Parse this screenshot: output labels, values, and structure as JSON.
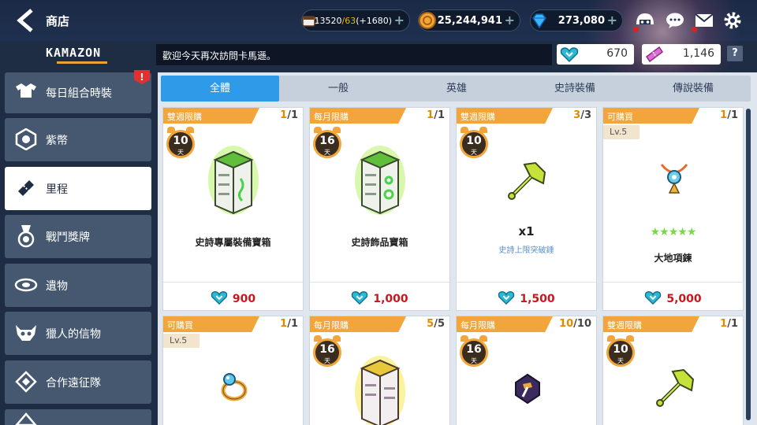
{
  "header": {
    "title": "商店",
    "stamina": {
      "current": "13520",
      "max": "/63",
      "bonus": "(+1680)",
      "icon": "coffee-cup-icon"
    },
    "gold": {
      "value": "25,244,941",
      "icon": "gold-coin-icon"
    },
    "gems": {
      "value": "273,080",
      "icon": "blue-gem-icon"
    },
    "icons": [
      "guild-helmet-icon",
      "chat-bubble-icon",
      "mail-icon",
      "gear-icon"
    ]
  },
  "shop": {
    "logo": "KAMAZON",
    "ticker": "歡迎今天再次訪問卡馬遜。",
    "tokens": [
      {
        "icon": "mileage-heart-icon",
        "value": "670"
      },
      {
        "icon": "ticket-icon",
        "value": "1,146"
      }
    ],
    "help": "?"
  },
  "sidebar": {
    "items": [
      {
        "label": "每日組合時裝",
        "icon": "costume-icon",
        "badge": "!"
      },
      {
        "label": "紫幣",
        "icon": "purple-coin-icon"
      },
      {
        "label": "里程",
        "icon": "ticket-tag-icon",
        "active": true
      },
      {
        "label": "戰鬥獎牌",
        "icon": "medal-icon"
      },
      {
        "label": "遺物",
        "icon": "relic-icon"
      },
      {
        "label": "獵人的信物",
        "icon": "hunter-skull-icon"
      },
      {
        "label": "合作遠征隊",
        "icon": "expedition-icon"
      }
    ]
  },
  "tabs": [
    "全體",
    "一般",
    "英雄",
    "史詩裝備",
    "傳說裝備"
  ],
  "cards": [
    {
      "tag": "雙週限購",
      "limit_a": "1",
      "limit_b": "/1",
      "days": "10",
      "days_unit": "天",
      "name": "史詩專屬裝備寶箱",
      "price": "900"
    },
    {
      "tag": "每月限購",
      "limit_a": "1",
      "limit_b": "/1",
      "days": "16",
      "days_unit": "天",
      "name": "史詩飾品寶箱",
      "price": "1,000"
    },
    {
      "tag": "雙週限購",
      "limit_a": "3",
      "limit_b": "/3",
      "days": "10",
      "days_unit": "天",
      "qty": "x1",
      "sub": "史詩上限突破錘",
      "price": "1,500"
    },
    {
      "tag": "可購買",
      "limit_a": "1",
      "limit_b": "/1",
      "lv": "Lv.5",
      "stars": "★★★★★",
      "name": "大地項鍊",
      "price": "5,000"
    },
    {
      "tag": "可購買",
      "limit_a": "1",
      "limit_b": "/1",
      "lv": "Lv.5"
    },
    {
      "tag": "每月限購",
      "limit_a": "5",
      "limit_b": "/5",
      "days": "16",
      "days_unit": "天"
    },
    {
      "tag": "每月限購",
      "limit_a": "10",
      "limit_b": "/10",
      "days": "16",
      "days_unit": "天"
    },
    {
      "tag": "雙週限購",
      "limit_a": "1",
      "limit_b": "/1",
      "days": "10",
      "days_unit": "天"
    }
  ],
  "colors": {
    "accent_tab": "#2f9ae8",
    "tag": "#f2a53a",
    "price": "#c8161d",
    "background": "#1e2c44"
  }
}
